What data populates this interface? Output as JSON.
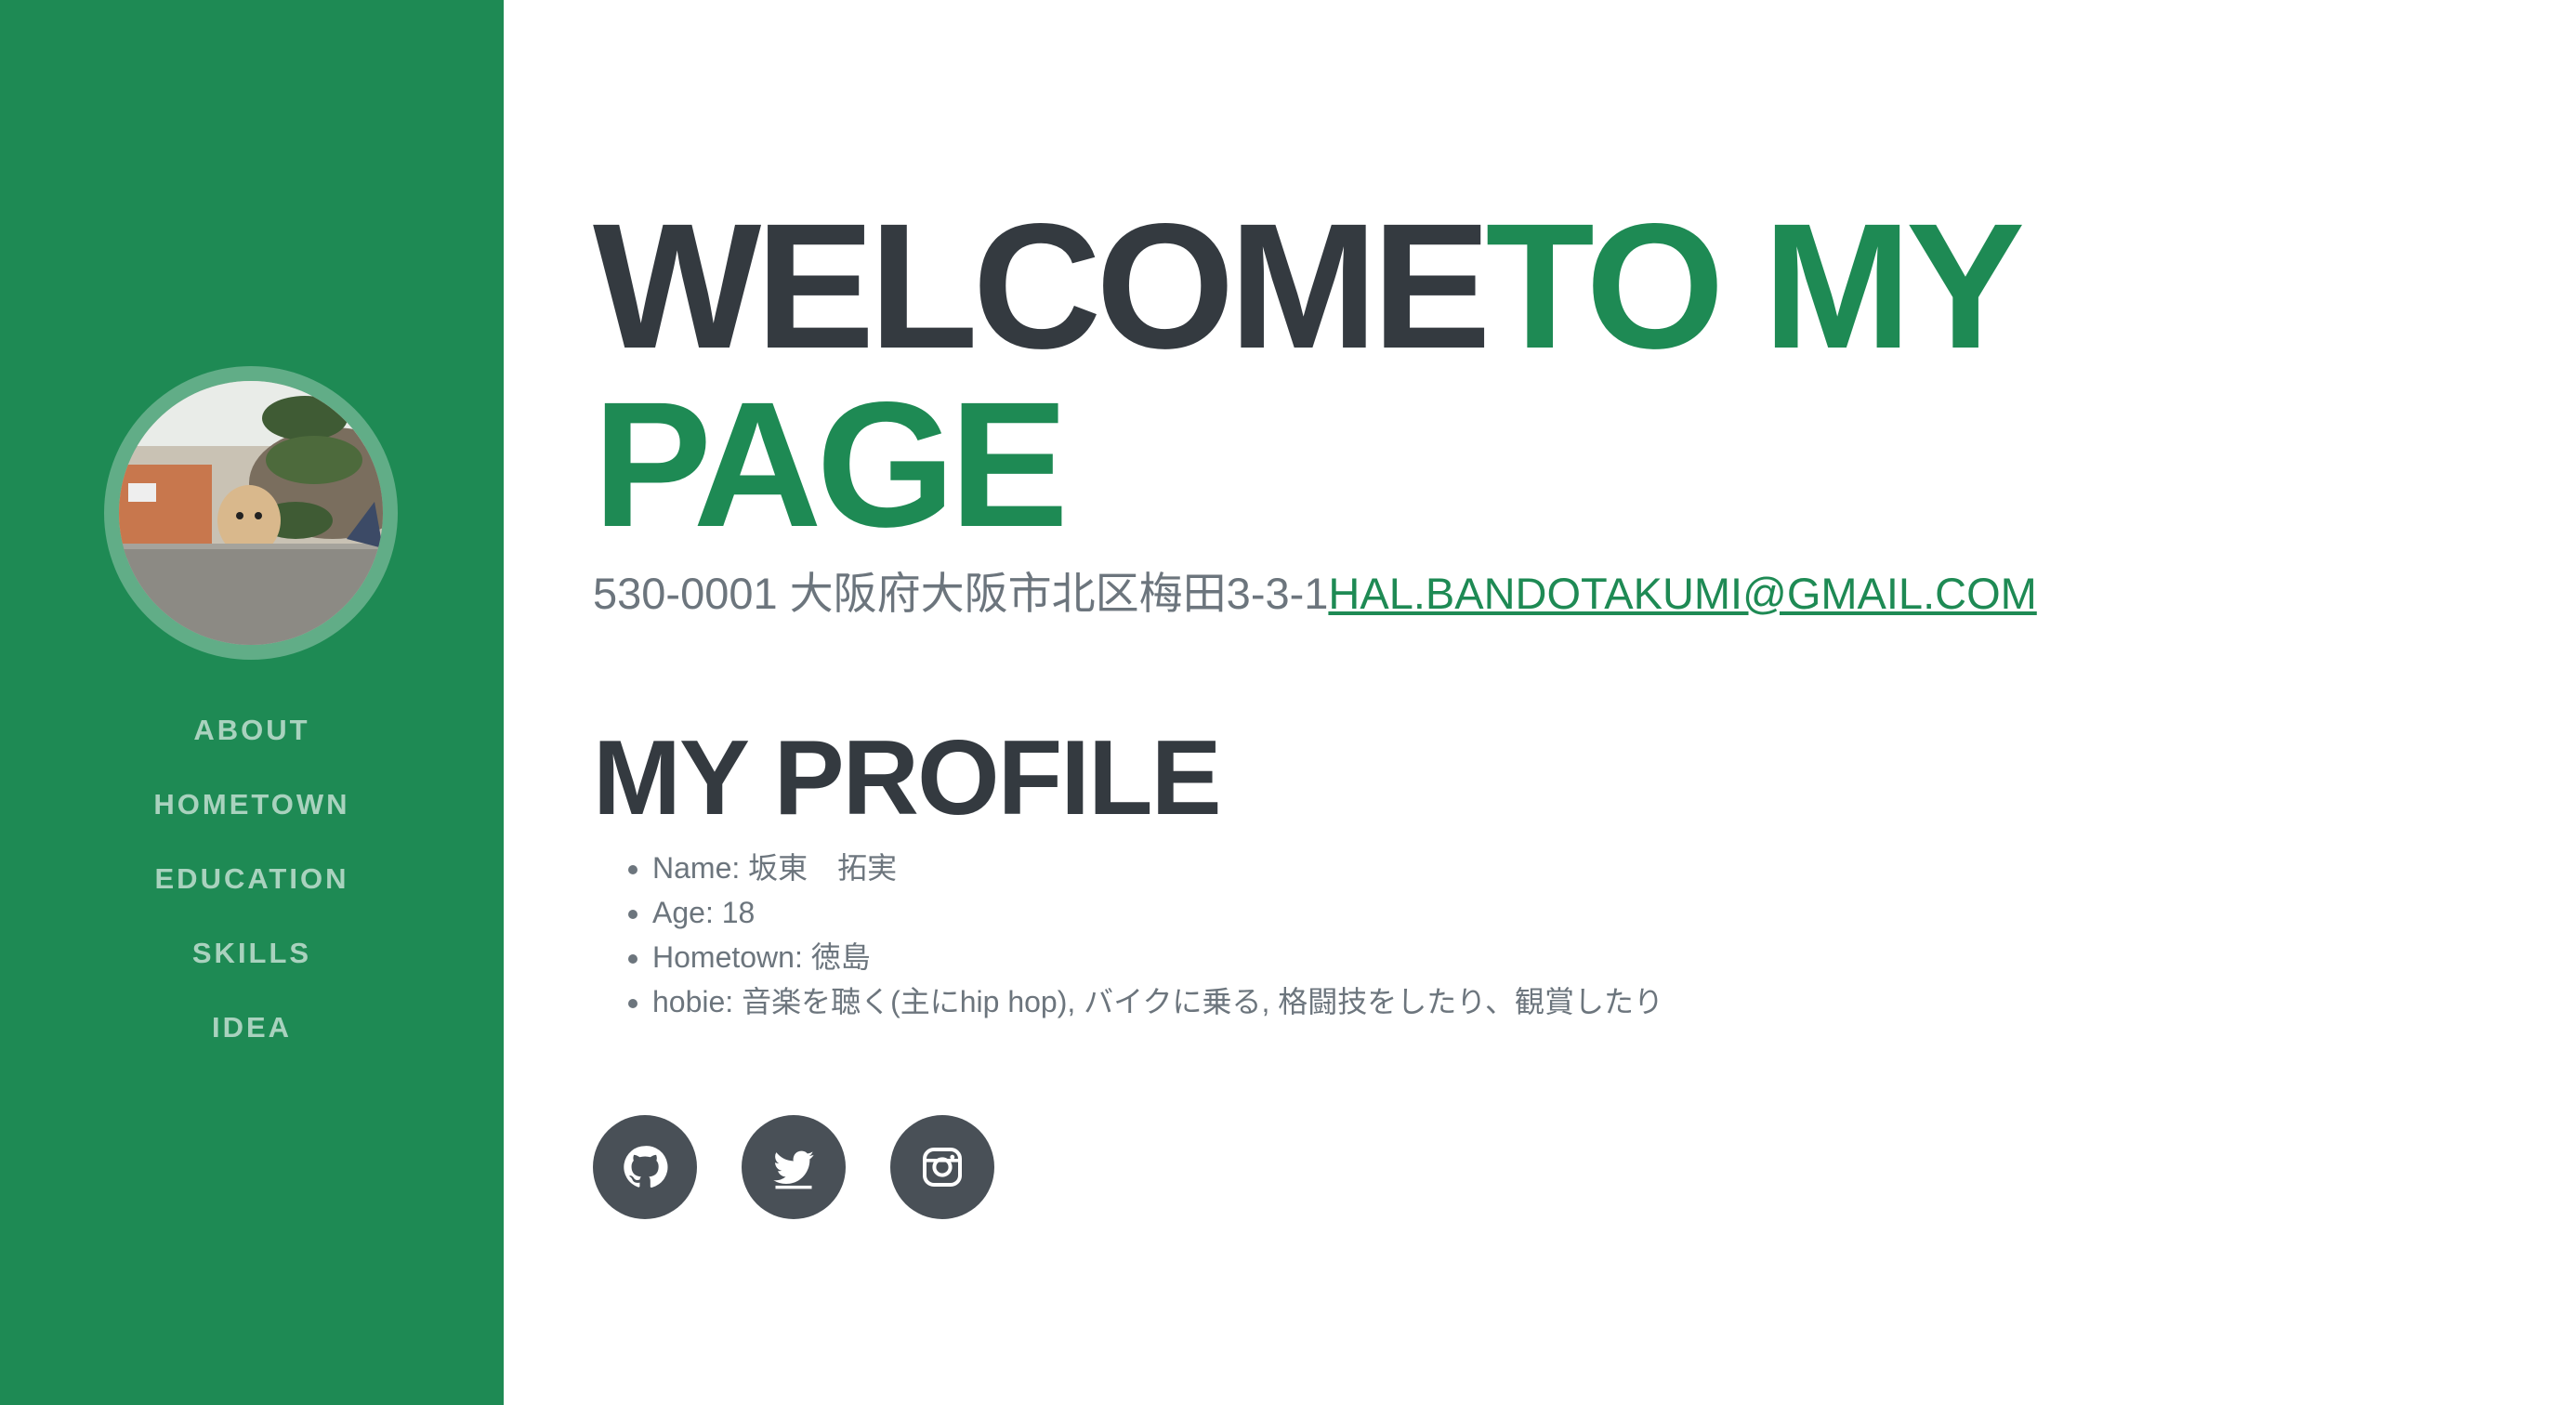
{
  "colors": {
    "primary": "#1e8a54",
    "dark": "#343a40",
    "muted": "#6c757d",
    "social_bg": "#495057"
  },
  "sidebar": {
    "avatar_alt": "",
    "nav": [
      {
        "label": "ABOUT"
      },
      {
        "label": "HOMETOWN"
      },
      {
        "label": "EDUCATION"
      },
      {
        "label": "SKILLS"
      },
      {
        "label": "IDEA"
      }
    ]
  },
  "main": {
    "headline_dark": "WELCOME",
    "headline_accent": "TO MY PAGE",
    "address": "530-0001 大阪府大阪市北区梅田3-3-1",
    "email": "HAL.BANDOTAKUMI@GMAIL.COM",
    "profile_title": "MY PROFILE",
    "profile_items": [
      "Name: 坂東　拓実",
      "Age: 18",
      "Hometown: 徳島",
      "hobie: 音楽を聴く(主にhip hop), バイクに乗る, 格闘技をしたり、観賞したり"
    ],
    "social": [
      {
        "icon": "github-icon"
      },
      {
        "icon": "twitter-icon"
      },
      {
        "icon": "instagram-icon"
      }
    ]
  }
}
